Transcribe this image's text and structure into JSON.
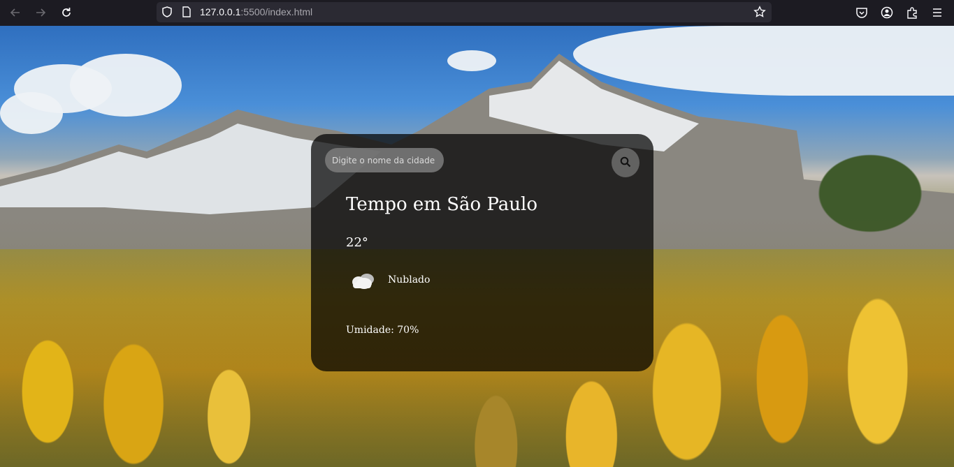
{
  "browser": {
    "url_host": "127.0.0.1",
    "url_rest": ":5500/index.html",
    "icons": [
      "back-icon",
      "forward-icon",
      "reload-icon",
      "shield-icon",
      "page-icon",
      "bookmark-star-icon",
      "pocket-icon",
      "account-icon",
      "extensions-icon",
      "menu-icon"
    ]
  },
  "weather": {
    "search_placeholder": "Digite o nome da cidade",
    "city_title": "Tempo em São Paulo",
    "temperature": "22°",
    "description": "Nublado",
    "humidity": "Umidade: 70%",
    "icon": "cloud-icon"
  },
  "colors": {
    "card_bg": "rgba(0,0,0,0.72)",
    "input_bg": "#7c7c7c",
    "text": "#ffffff"
  }
}
